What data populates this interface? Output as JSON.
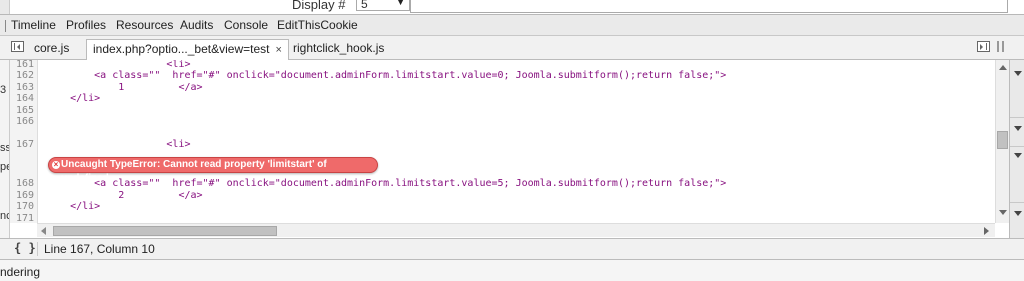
{
  "page": {
    "display_label": "Display #",
    "display_value": "5",
    "bottom_status": "ndering"
  },
  "panel_tabs": [
    "Timeline",
    "Profiles",
    "Resources",
    "Audits",
    "Console",
    "EditThisCookie"
  ],
  "file_tabs": [
    {
      "label": "core.js",
      "active": false
    },
    {
      "label": "index.php?optio..._bet&view=test",
      "active": true,
      "close": "×"
    },
    {
      "label": "rightclick_hook.js",
      "active": false
    }
  ],
  "left_fragments": [
    "3",
    "ss",
    "pe",
    "nc"
  ],
  "code_lines": [
    {
      "ln": "161",
      "text": "                    <li>"
    },
    {
      "ln": "162",
      "text": "        <a class=\"\"  href=\"#\" onclick=\"document.adminForm.limitstart.value=0; Joomla.submitform();return false;\">"
    },
    {
      "ln": "163",
      "text": "            1         </a>"
    },
    {
      "ln": "164",
      "text": "    </li>"
    },
    {
      "ln": "165",
      "text": ""
    },
    {
      "ln": "166",
      "text": ""
    },
    {
      "ln": "167",
      "text": "                    <li>"
    },
    {
      "ln": "168",
      "text": "        <a class=\"\"  href=\"#\" onclick=\"document.adminForm.limitstart.value=5; Joomla.submitform();return false;\">"
    },
    {
      "ln": "169",
      "text": "            2         </a>"
    },
    {
      "ln": "170",
      "text": "    </li>"
    },
    {
      "ln": "171",
      "text": ""
    }
  ],
  "error": {
    "icon": "×",
    "message": "Uncaught TypeError: Cannot read property 'limitstart' of undefined"
  },
  "status": {
    "pretty_print": "{ }",
    "cursor": "Line 167, Column 10"
  }
}
